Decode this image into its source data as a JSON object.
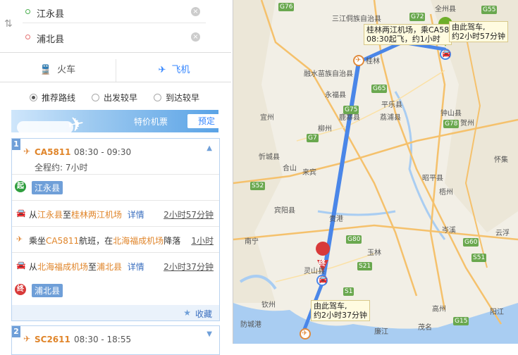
{
  "search": {
    "origin": "江永县",
    "destination": "浦北县"
  },
  "tabs": {
    "train": "火车",
    "plane": "飞机"
  },
  "options": [
    "推荐路线",
    "出发较早",
    "到达较早"
  ],
  "banner": {
    "text": "特价机票",
    "button": "预定"
  },
  "route1": {
    "index": "1",
    "flight_no": "CA5811",
    "time": "08:30 - 09:30",
    "total": "全程约: 7小时",
    "start_badge": "起",
    "start": "江永县",
    "steps": [
      {
        "pre": "从",
        "from": "江永县",
        "mid": "至",
        "to": "桂林两江机场",
        "detail": "详情",
        "duration": "2小时57分钟"
      },
      {
        "pre": "乘坐",
        "flight": "CA5811",
        "mid": "航班，在",
        "airport": "北海福成机场",
        "post": "降落",
        "duration": "1小时"
      },
      {
        "pre": "从",
        "from": "北海福成机场",
        "mid": "至",
        "to": "浦北县",
        "detail": "详情",
        "duration": "2小时37分钟"
      }
    ],
    "end_badge": "终",
    "end": "浦北县",
    "fav": "收藏"
  },
  "route2": {
    "index": "2",
    "flight_no": "SC2611",
    "time": "08:30 - 18:55"
  },
  "map": {
    "callout_top": [
      "桂林两江机场，乘CA58",
      "08:30起飞，约1小时"
    ],
    "callout_drive1": [
      "由此驾车,",
      "约2小时57分钟"
    ],
    "callout_drive2": [
      "由此驾车,",
      "约2小时37分钟"
    ],
    "start_marker": "起",
    "end_marker": "终",
    "places": [
      "三江侗族自治县",
      "桂林",
      "融水苗族自治县",
      "永福县",
      "平乐县",
      "荔浦县",
      "鹿寨县",
      "钟山县",
      "贺州",
      "柳州",
      "宜州",
      "忻城县",
      "来宾",
      "合山",
      "昭平县",
      "宾阳县",
      "贵港",
      "梧州",
      "南宁",
      "玉林",
      "岑溪",
      "云浮",
      "灵山县",
      "钦州",
      "防城港",
      "廉江",
      "茂名",
      "高州",
      "阳江",
      "怀集",
      "全州县"
    ],
    "roads": [
      "G76",
      "G72",
      "G65",
      "G55",
      "G75",
      "G78",
      "G80",
      "S21",
      "G15",
      "S52",
      "S51",
      "G7",
      "G60",
      "S1"
    ]
  },
  "colors": {
    "accent": "#3385ff",
    "route": "#4a86e8",
    "start": "#2e9e3e",
    "end": "#d83a3a"
  }
}
